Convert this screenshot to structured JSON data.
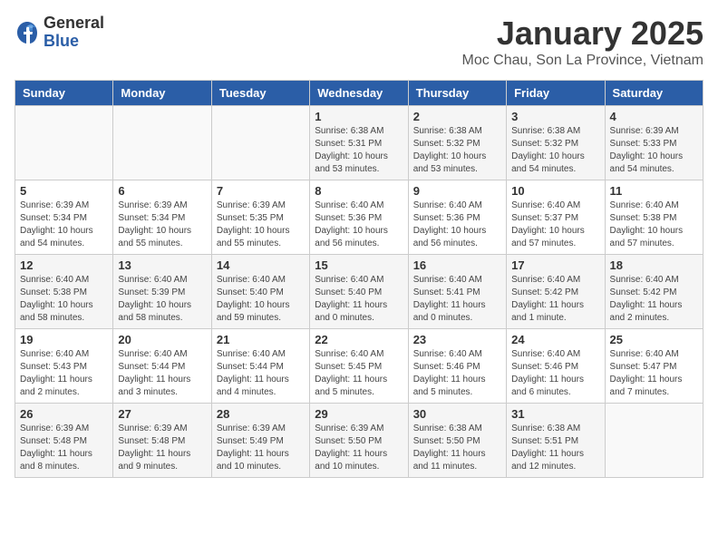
{
  "logo": {
    "general": "General",
    "blue": "Blue"
  },
  "header": {
    "month_year": "January 2025",
    "location": "Moc Chau, Son La Province, Vietnam"
  },
  "weekdays": [
    "Sunday",
    "Monday",
    "Tuesday",
    "Wednesday",
    "Thursday",
    "Friday",
    "Saturday"
  ],
  "weeks": [
    [
      {
        "day": "",
        "info": ""
      },
      {
        "day": "",
        "info": ""
      },
      {
        "day": "",
        "info": ""
      },
      {
        "day": "1",
        "info": "Sunrise: 6:38 AM\nSunset: 5:31 PM\nDaylight: 10 hours\nand 53 minutes."
      },
      {
        "day": "2",
        "info": "Sunrise: 6:38 AM\nSunset: 5:32 PM\nDaylight: 10 hours\nand 53 minutes."
      },
      {
        "day": "3",
        "info": "Sunrise: 6:38 AM\nSunset: 5:32 PM\nDaylight: 10 hours\nand 54 minutes."
      },
      {
        "day": "4",
        "info": "Sunrise: 6:39 AM\nSunset: 5:33 PM\nDaylight: 10 hours\nand 54 minutes."
      }
    ],
    [
      {
        "day": "5",
        "info": "Sunrise: 6:39 AM\nSunset: 5:34 PM\nDaylight: 10 hours\nand 54 minutes."
      },
      {
        "day": "6",
        "info": "Sunrise: 6:39 AM\nSunset: 5:34 PM\nDaylight: 10 hours\nand 55 minutes."
      },
      {
        "day": "7",
        "info": "Sunrise: 6:39 AM\nSunset: 5:35 PM\nDaylight: 10 hours\nand 55 minutes."
      },
      {
        "day": "8",
        "info": "Sunrise: 6:40 AM\nSunset: 5:36 PM\nDaylight: 10 hours\nand 56 minutes."
      },
      {
        "day": "9",
        "info": "Sunrise: 6:40 AM\nSunset: 5:36 PM\nDaylight: 10 hours\nand 56 minutes."
      },
      {
        "day": "10",
        "info": "Sunrise: 6:40 AM\nSunset: 5:37 PM\nDaylight: 10 hours\nand 57 minutes."
      },
      {
        "day": "11",
        "info": "Sunrise: 6:40 AM\nSunset: 5:38 PM\nDaylight: 10 hours\nand 57 minutes."
      }
    ],
    [
      {
        "day": "12",
        "info": "Sunrise: 6:40 AM\nSunset: 5:38 PM\nDaylight: 10 hours\nand 58 minutes."
      },
      {
        "day": "13",
        "info": "Sunrise: 6:40 AM\nSunset: 5:39 PM\nDaylight: 10 hours\nand 58 minutes."
      },
      {
        "day": "14",
        "info": "Sunrise: 6:40 AM\nSunset: 5:40 PM\nDaylight: 10 hours\nand 59 minutes."
      },
      {
        "day": "15",
        "info": "Sunrise: 6:40 AM\nSunset: 5:40 PM\nDaylight: 11 hours\nand 0 minutes."
      },
      {
        "day": "16",
        "info": "Sunrise: 6:40 AM\nSunset: 5:41 PM\nDaylight: 11 hours\nand 0 minutes."
      },
      {
        "day": "17",
        "info": "Sunrise: 6:40 AM\nSunset: 5:42 PM\nDaylight: 11 hours\nand 1 minute."
      },
      {
        "day": "18",
        "info": "Sunrise: 6:40 AM\nSunset: 5:42 PM\nDaylight: 11 hours\nand 2 minutes."
      }
    ],
    [
      {
        "day": "19",
        "info": "Sunrise: 6:40 AM\nSunset: 5:43 PM\nDaylight: 11 hours\nand 2 minutes."
      },
      {
        "day": "20",
        "info": "Sunrise: 6:40 AM\nSunset: 5:44 PM\nDaylight: 11 hours\nand 3 minutes."
      },
      {
        "day": "21",
        "info": "Sunrise: 6:40 AM\nSunset: 5:44 PM\nDaylight: 11 hours\nand 4 minutes."
      },
      {
        "day": "22",
        "info": "Sunrise: 6:40 AM\nSunset: 5:45 PM\nDaylight: 11 hours\nand 5 minutes."
      },
      {
        "day": "23",
        "info": "Sunrise: 6:40 AM\nSunset: 5:46 PM\nDaylight: 11 hours\nand 5 minutes."
      },
      {
        "day": "24",
        "info": "Sunrise: 6:40 AM\nSunset: 5:46 PM\nDaylight: 11 hours\nand 6 minutes."
      },
      {
        "day": "25",
        "info": "Sunrise: 6:40 AM\nSunset: 5:47 PM\nDaylight: 11 hours\nand 7 minutes."
      }
    ],
    [
      {
        "day": "26",
        "info": "Sunrise: 6:39 AM\nSunset: 5:48 PM\nDaylight: 11 hours\nand 8 minutes."
      },
      {
        "day": "27",
        "info": "Sunrise: 6:39 AM\nSunset: 5:48 PM\nDaylight: 11 hours\nand 9 minutes."
      },
      {
        "day": "28",
        "info": "Sunrise: 6:39 AM\nSunset: 5:49 PM\nDaylight: 11 hours\nand 10 minutes."
      },
      {
        "day": "29",
        "info": "Sunrise: 6:39 AM\nSunset: 5:50 PM\nDaylight: 11 hours\nand 10 minutes."
      },
      {
        "day": "30",
        "info": "Sunrise: 6:38 AM\nSunset: 5:50 PM\nDaylight: 11 hours\nand 11 minutes."
      },
      {
        "day": "31",
        "info": "Sunrise: 6:38 AM\nSunset: 5:51 PM\nDaylight: 11 hours\nand 12 minutes."
      },
      {
        "day": "",
        "info": ""
      }
    ]
  ]
}
